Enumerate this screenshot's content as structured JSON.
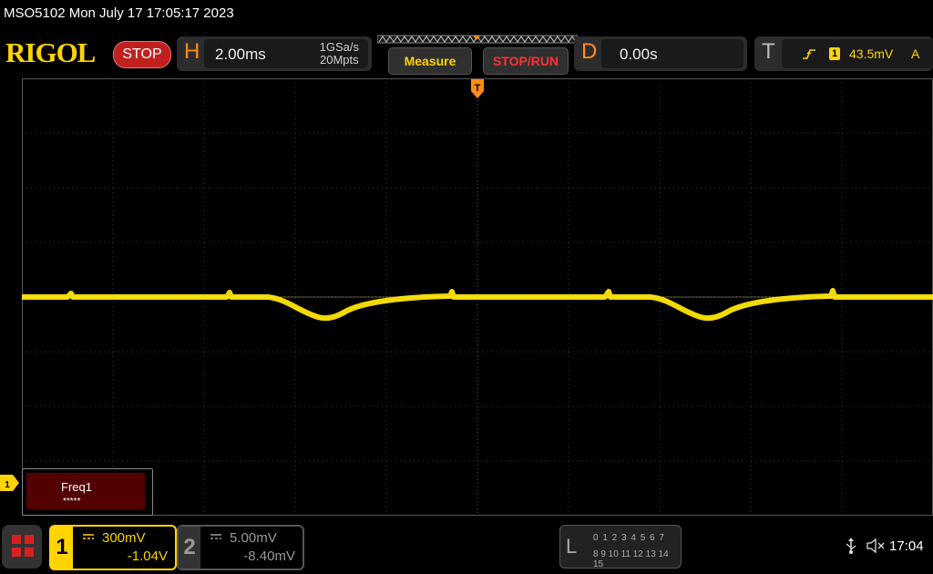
{
  "header": {
    "title": "MSO5102  Mon July 17 17:05:17 2023",
    "logo": "RIGOL",
    "status": "STOP"
  },
  "horizontal": {
    "letter": "H",
    "timebase": "2.00ms",
    "sample_rate": "1GSa/s",
    "memory_depth": "20Mpts"
  },
  "buttons": {
    "measure": "Measure",
    "stop_run": "STOP/RUN"
  },
  "delay": {
    "letter": "D",
    "value": "0.00s"
  },
  "trigger": {
    "letter": "T",
    "source": "1",
    "level": "43.5mV",
    "mode": "A",
    "marker_label": "T"
  },
  "measurement": {
    "name": "Freq1",
    "value": "*****"
  },
  "channel1": {
    "number": "1",
    "scale": "300mV",
    "offset": "-1.04V",
    "color": "#ffd400",
    "marker_label": "1"
  },
  "channel2": {
    "number": "2",
    "scale": "5.00mV",
    "offset": "-8.40mV",
    "color": "#999999"
  },
  "logic": {
    "letter": "L",
    "row1": "0 1 2 3   4 5 6 7",
    "row2": "8  9 10 11  12 13 14 15"
  },
  "status_bar": {
    "usb_icon": "usb-icon",
    "sound_icon": "muted-speaker-icon",
    "time": "17:04"
  }
}
